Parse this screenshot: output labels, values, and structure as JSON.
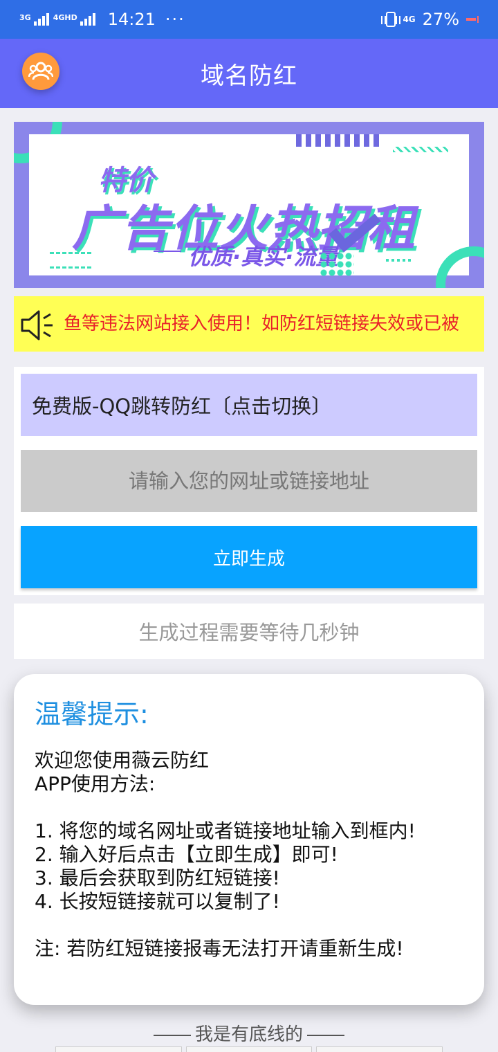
{
  "status_bar": {
    "network1": "3G",
    "network2": "4GHD",
    "time": "14:21",
    "more": "···",
    "network3": "4G",
    "battery": "27%"
  },
  "app_bar": {
    "title": "域名防红"
  },
  "banner": {
    "line1": "特价",
    "line2": "广告位火热招租",
    "line3": "优质·真实·流量"
  },
  "notice": {
    "text": "鱼等违法网站接入使用！如防红短链接失效或已被"
  },
  "form": {
    "mode_label": "免费版-QQ跳转防红〔点击切换〕",
    "url_placeholder": "请输入您的网址或链接地址",
    "url_value": "",
    "generate_label": "立即生成"
  },
  "wait_text": "生成过程需要等待几秒钟",
  "tips": {
    "title": "温馨提示:",
    "lines": [
      "欢迎您使用薇云防红",
      "APP使用方法:",
      "1. 将您的域名网址或者链接地址输入到框内!",
      "2. 输入好后点击【立即生成】即可!",
      "3. 最后会获取到防红短链接!",
      "4. 长按短链接就可以复制了!",
      "注: 若防红短链接报毒无法打开请重新生成!"
    ]
  },
  "footer": {
    "text": "我是有底线的"
  },
  "colors": {
    "status_bar": "#2f6ee6",
    "app_bar": "#6468f8",
    "mode_button": "#cdcbff",
    "input_bg": "#cbcbcb",
    "generate_button": "#08a3ff",
    "notice_bg": "#ffff55",
    "notice_text": "#e8202a",
    "tips_title": "#1e8fe0"
  }
}
